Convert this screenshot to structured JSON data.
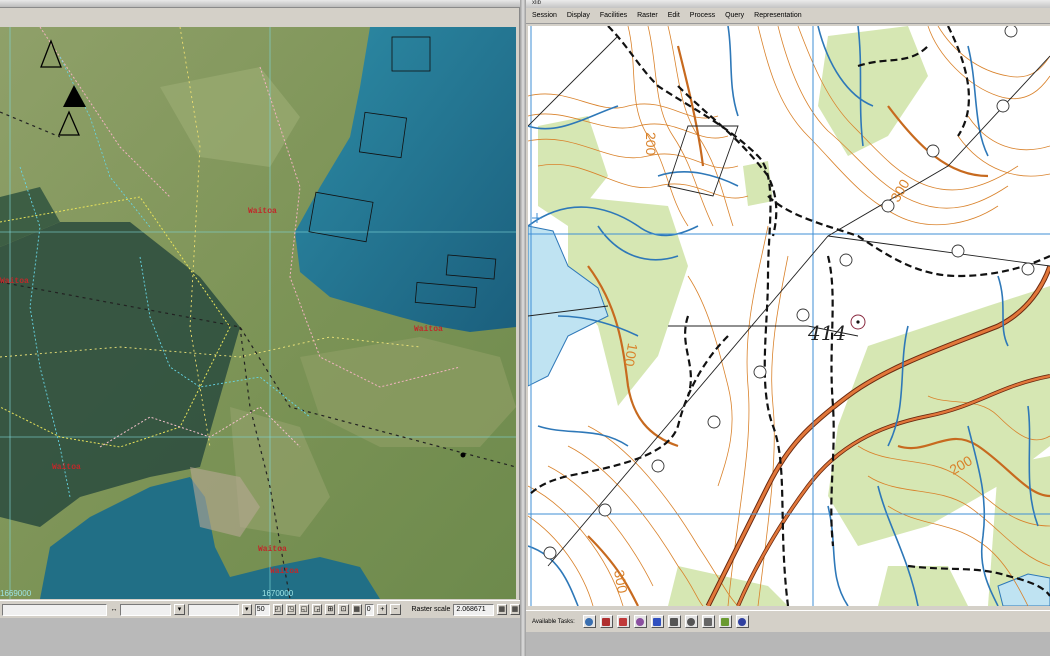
{
  "left_window": {
    "status": {
      "swap_icon": "↔",
      "zoom_value": "50",
      "zoom_tool_labels": [
        "◰",
        "◳",
        "◱",
        "◲",
        "⊞",
        "⊡",
        "▦"
      ],
      "zoom_in_label": "+",
      "zoom_out_label": "−",
      "raster_scale_label": "Raster scale",
      "raster_scale_value": "2.068671",
      "extra_value": "0"
    },
    "map_labels": [
      {
        "text": "Waitoa"
      },
      {
        "text": "Waitoa"
      },
      {
        "text": "Waitoa"
      },
      {
        "text": "Waitoa"
      },
      {
        "text": "Waitoa"
      },
      {
        "text": "Waitoa"
      }
    ],
    "coord_labels": [
      "1669000",
      "1670000"
    ]
  },
  "right_window": {
    "title": "xlib",
    "menu": [
      "Session",
      "Display",
      "Facilities",
      "Raster",
      "Edit",
      "Process",
      "Query",
      "Representation"
    ],
    "available_tasks_label": "Available Tasks:",
    "task_icons": [
      "move-icon",
      "edit-icon",
      "draw-icon",
      "brush-icon",
      "select-icon",
      "zoom-window-icon",
      "pan-icon",
      "layer-icon",
      "color-icon",
      "palette-icon"
    ],
    "map_labels": {
      "spot_height": "414",
      "contours": [
        "200",
        "300",
        "100",
        "200",
        "300"
      ]
    }
  },
  "colors": {
    "contour": "#d9822b",
    "water": "#2e78b8",
    "vegetation": "#c9dfa0",
    "sea": "#1f6f8b",
    "label_red": "#c0282a"
  }
}
